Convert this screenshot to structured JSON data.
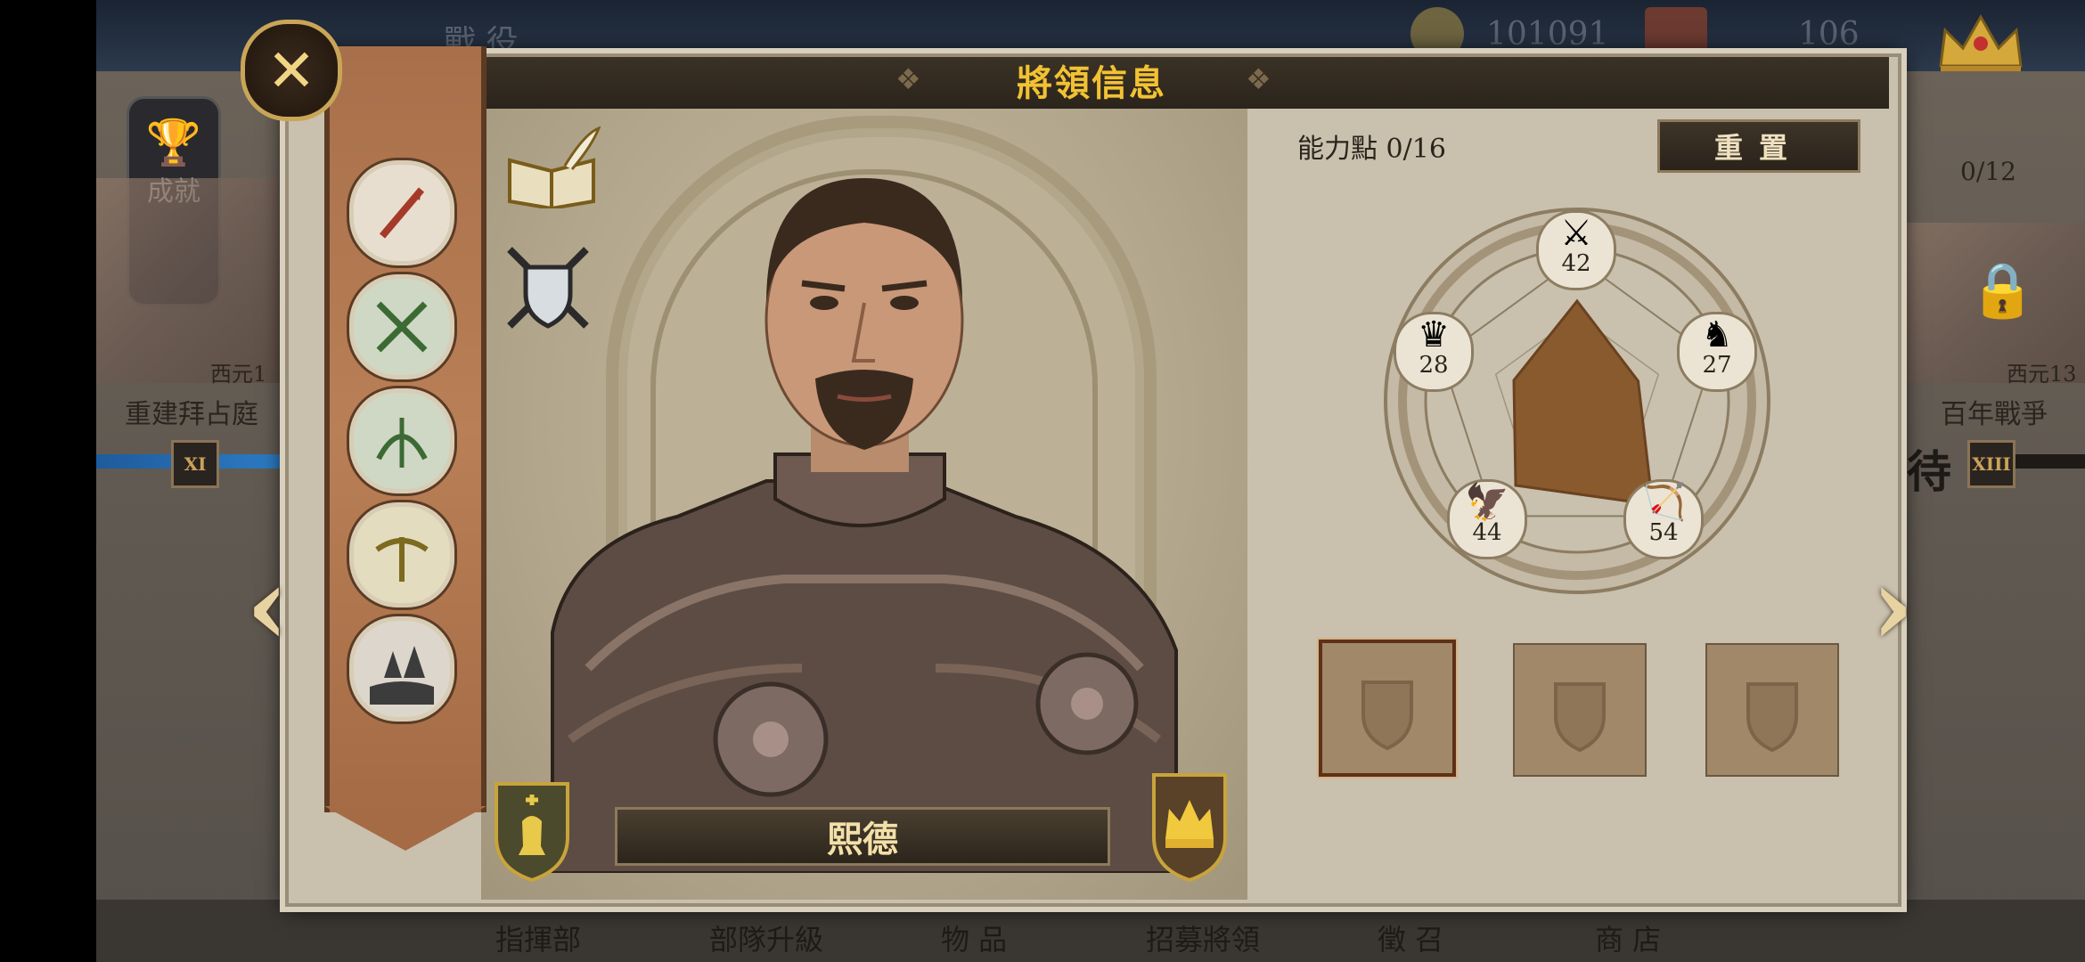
{
  "background": {
    "top_title": "戰 役",
    "gold": "101091",
    "gems": "106",
    "achievements_label": "成就",
    "left_scene_year": "西元1",
    "left_scene_title": "重建拜占庭",
    "left_scene_numeral": "XI",
    "right_progress": "0/12",
    "right_scene_year": "西元13",
    "right_scene_title": "百年戰爭",
    "right_scene_status": "待",
    "right_scene_numeral": "XIII",
    "bottom_tabs": [
      "指揮部",
      "部隊升級",
      "物 品",
      "招募將領",
      "徵 召",
      "商 店"
    ]
  },
  "modal": {
    "title": "將領信息",
    "general_name": "熙德",
    "ability_points_label": "能力點 0/16",
    "reset_label": "重置",
    "stats": {
      "melee": "42",
      "cavalry": "27",
      "ranged": "54",
      "defense": "44",
      "command": "28"
    },
    "radar": {
      "melee": 42,
      "cavalry": 27,
      "ranged": 54,
      "defense": 44,
      "command": 28
    },
    "skill_icons": [
      "spear-skill",
      "crossed-swords-skill",
      "bow-skill",
      "crossbow-skill",
      "forest-terrain-skill"
    ],
    "equipment_slots": 3
  },
  "colors": {
    "title_gold": "#f2c233",
    "banner": "#b27a52",
    "panel": "#c9c0ae",
    "radar_fill": "#8a5a2f"
  }
}
